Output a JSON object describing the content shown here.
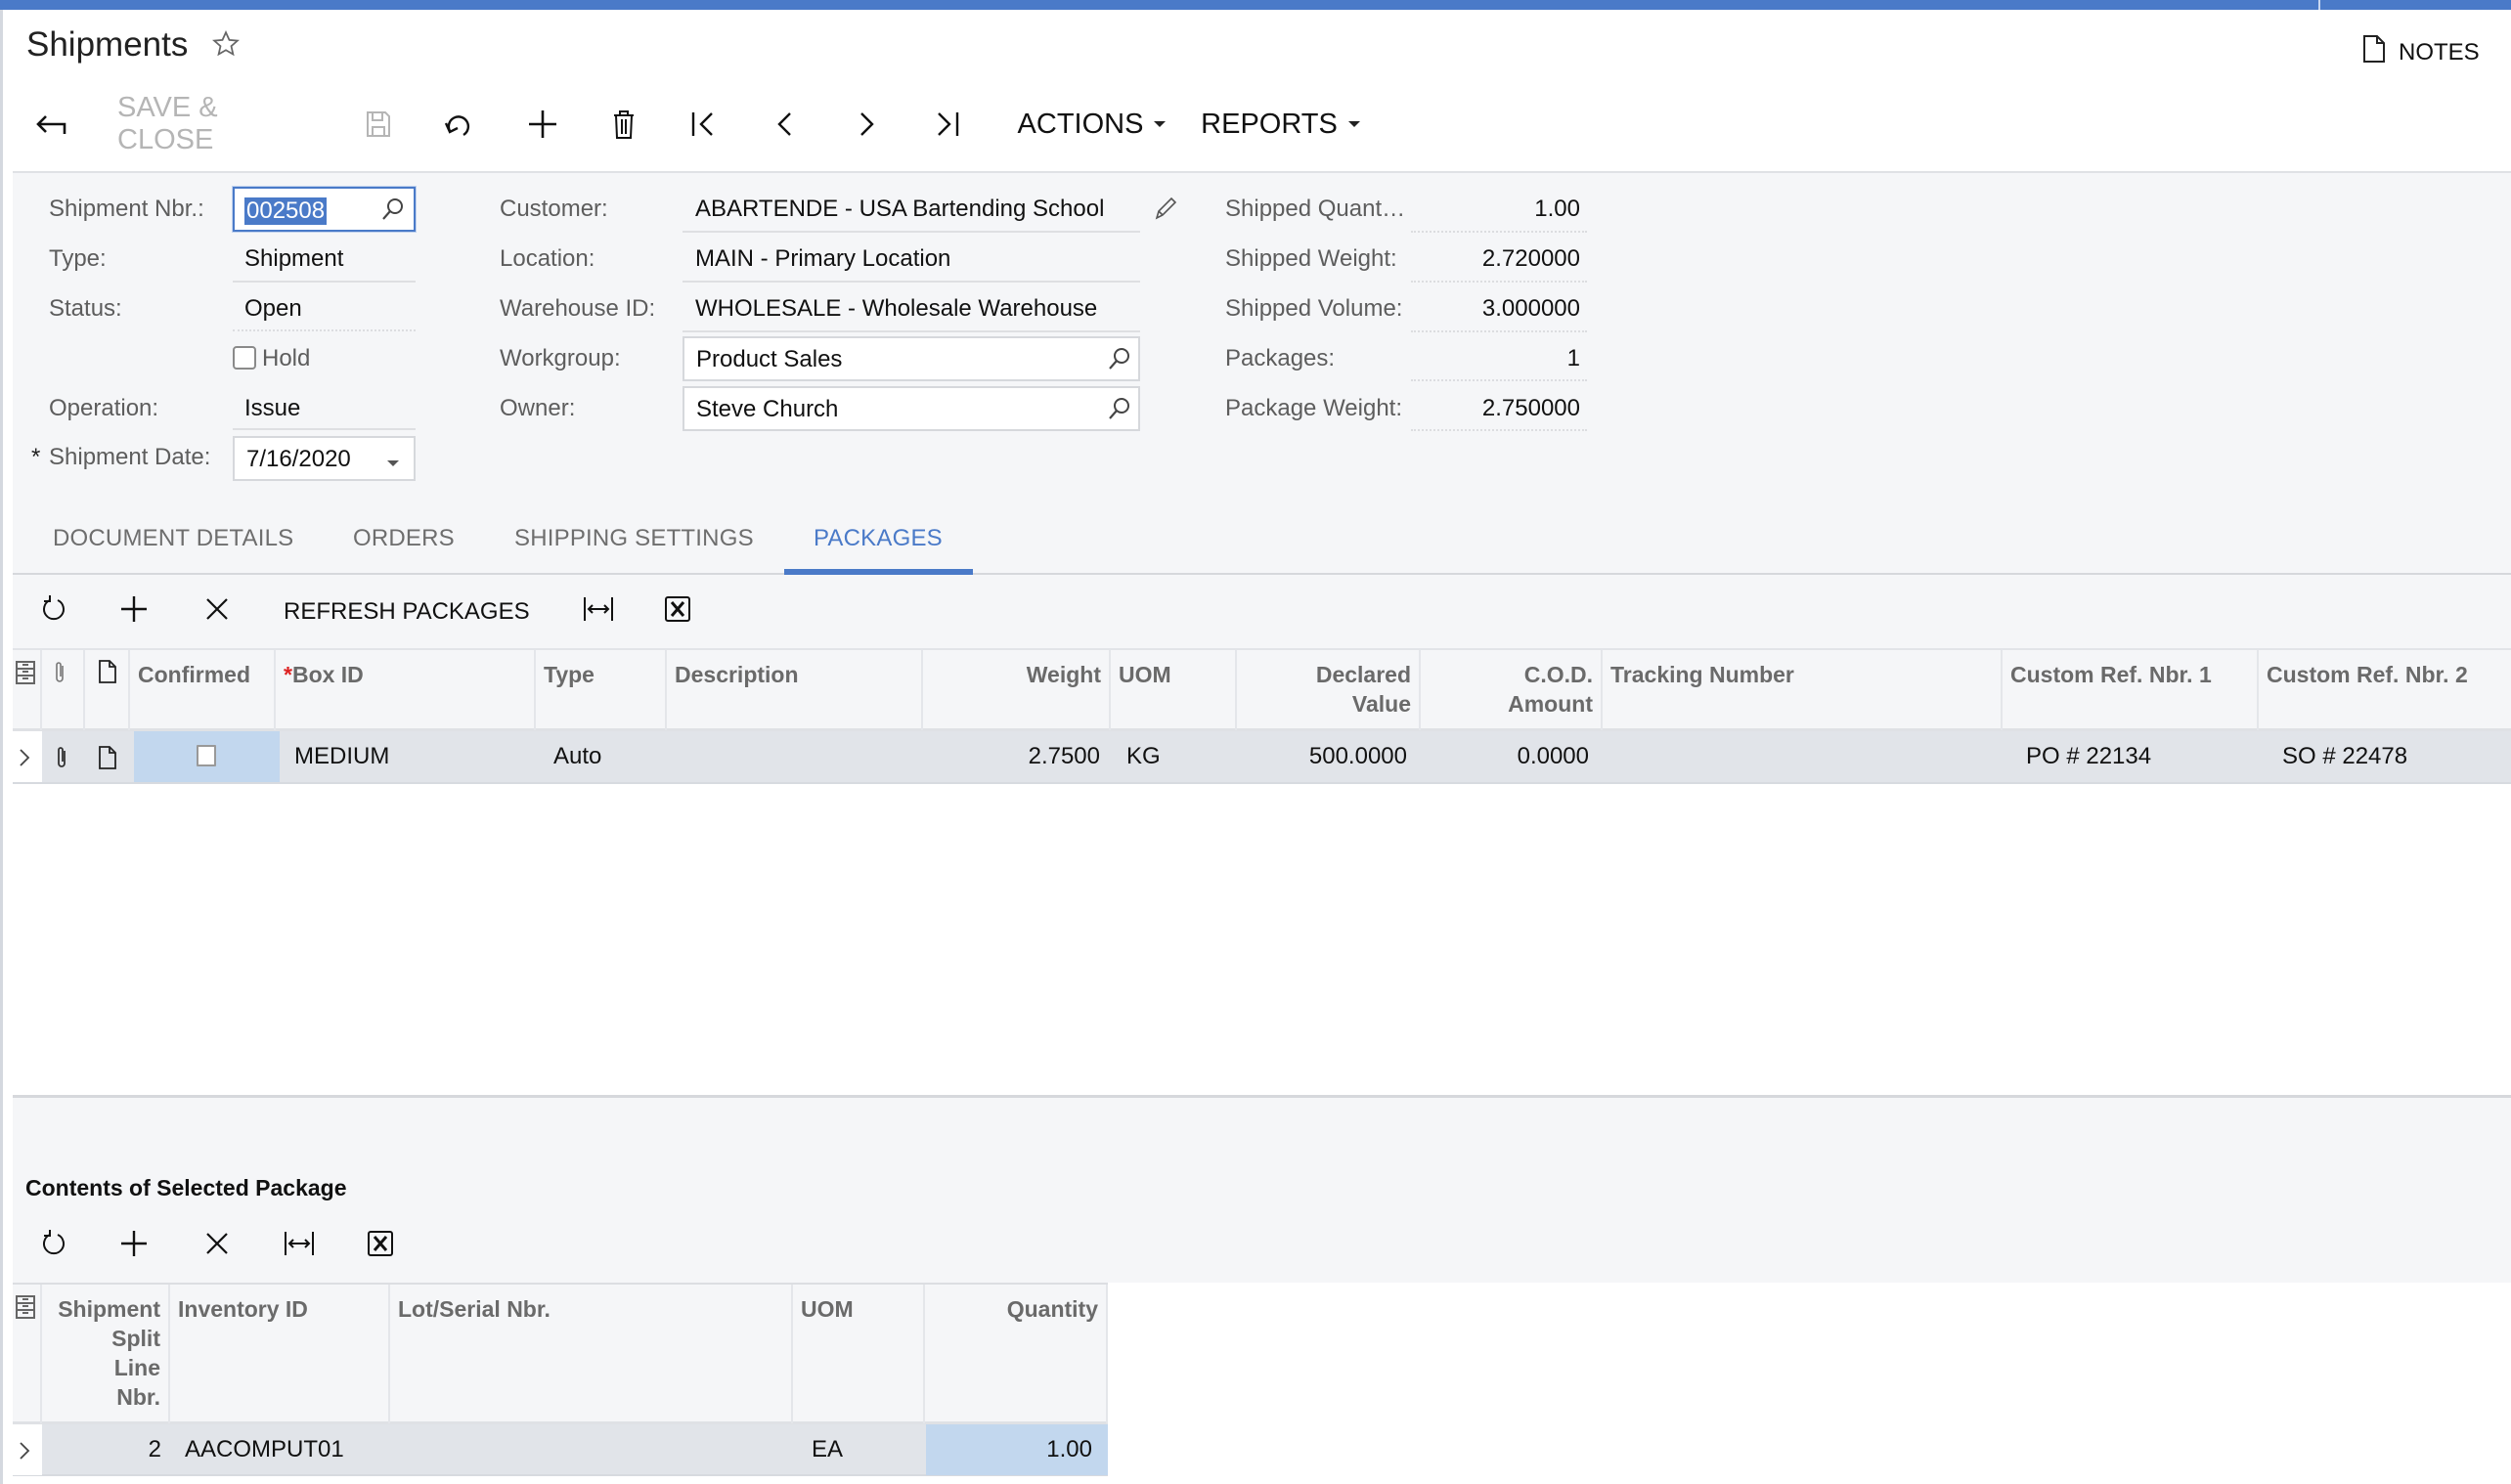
{
  "header": {
    "title": "Shipments",
    "notes_label": "NOTES"
  },
  "toolbar": {
    "save_close_label": "SAVE & CLOSE",
    "actions_label": "ACTIONS",
    "reports_label": "REPORTS"
  },
  "form": {
    "shipment_nbr": {
      "label": "Shipment Nbr.:",
      "value": "002508"
    },
    "type": {
      "label": "Type:",
      "value": "Shipment"
    },
    "status": {
      "label": "Status:",
      "value": "Open"
    },
    "hold": {
      "label": "Hold",
      "checked": false
    },
    "operation": {
      "label": "Operation:",
      "value": "Issue"
    },
    "shipment_date": {
      "label": "Shipment Date:",
      "value": "7/16/2020",
      "required_mark": "*"
    },
    "customer": {
      "label": "Customer:",
      "value": "ABARTENDE - USA Bartending School"
    },
    "location": {
      "label": "Location:",
      "value": "MAIN - Primary Location"
    },
    "warehouse": {
      "label": "Warehouse ID:",
      "value": "WHOLESALE - Wholesale Warehouse"
    },
    "workgroup": {
      "label": "Workgroup:",
      "value": "Product Sales"
    },
    "owner": {
      "label": "Owner:",
      "value": "Steve Church"
    },
    "shipped_quantity": {
      "label": "Shipped Quant…",
      "value": "1.00"
    },
    "shipped_weight": {
      "label": "Shipped Weight:",
      "value": "2.720000"
    },
    "shipped_volume": {
      "label": "Shipped Volume:",
      "value": "3.000000"
    },
    "packages": {
      "label": "Packages:",
      "value": "1"
    },
    "package_weight": {
      "label": "Package Weight:",
      "value": "2.750000"
    }
  },
  "tabs": [
    {
      "label": "DOCUMENT DETAILS",
      "active": false
    },
    {
      "label": "ORDERS",
      "active": false
    },
    {
      "label": "SHIPPING SETTINGS",
      "active": false
    },
    {
      "label": "PACKAGES",
      "active": true
    }
  ],
  "packages_grid": {
    "toolbar": {
      "refresh_packages_label": "REFRESH PACKAGES"
    },
    "columns": {
      "confirmed": "Confirmed",
      "box_id": "Box ID",
      "box_id_required": "*",
      "type": "Type",
      "description": "Description",
      "weight": "Weight",
      "uom": "UOM",
      "declared_value_1": "Declared",
      "declared_value_2": "Value",
      "cod_amount_1": "C.O.D.",
      "cod_amount_2": "Amount",
      "tracking_number": "Tracking Number",
      "custom_ref_1": "Custom Ref. Nbr. 1",
      "custom_ref_2": "Custom Ref. Nbr. 2"
    },
    "rows": [
      {
        "confirmed": false,
        "box_id": "MEDIUM",
        "type": "Auto",
        "description": "",
        "weight": "2.7500",
        "uom": "KG",
        "declared_value": "500.0000",
        "cod_amount": "0.0000",
        "tracking_number": "",
        "custom_ref_1": "PO # 22134",
        "custom_ref_2": "SO # 22478"
      }
    ]
  },
  "contents_grid": {
    "title": "Contents of Selected Package",
    "columns": {
      "split_line_1": "Shipment",
      "split_line_2": "Split",
      "split_line_3": "Line",
      "split_line_4": "Nbr.",
      "inventory_id": "Inventory ID",
      "lot_serial": "Lot/Serial Nbr.",
      "uom": "UOM",
      "quantity": "Quantity"
    },
    "rows": [
      {
        "split_line_nbr": "2",
        "inventory_id": "AACOMPUT01",
        "lot_serial": "",
        "uom": "EA",
        "quantity": "1.00"
      }
    ]
  },
  "colors": {
    "accent": "#4a7ac8",
    "panel_bg": "#f5f6f8",
    "row_bg": "#e1e4e9",
    "selected_cell": "#c2d7ee"
  }
}
